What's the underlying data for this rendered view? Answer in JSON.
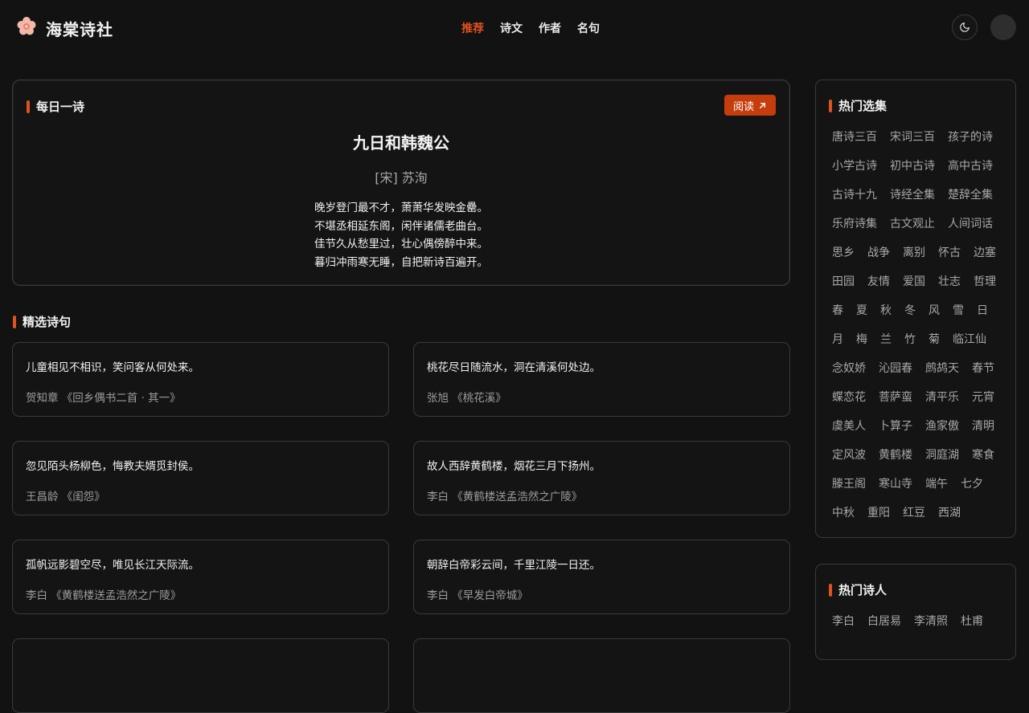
{
  "header": {
    "brand": "海棠诗社",
    "nav": [
      {
        "label": "推荐",
        "active": true
      },
      {
        "label": "诗文",
        "active": false
      },
      {
        "label": "作者",
        "active": false
      },
      {
        "label": "名句",
        "active": false
      }
    ],
    "theme_icon": "moon-icon",
    "logo_icon": "flower-icon"
  },
  "daily": {
    "section_title": "每日一诗",
    "read_label": "阅读",
    "read_icon": "arrow-up-right-icon",
    "title": "九日和韩魏公",
    "author": "[宋] 苏洵",
    "lines": [
      "晚岁登门最不才，萧萧华发映金罍。",
      "不堪丞相延东阁，闲伴诸儒老曲台。",
      "佳节久从愁里过，壮心偶傍醉中来。",
      "暮归冲雨寒无睡，自把新诗百遍开。"
    ]
  },
  "featured": {
    "section_title": "精选诗句",
    "quotes": [
      {
        "text": "儿童相见不相识，笑问客从何处来。",
        "source": "贺知章 《回乡偶书二首 · 其一》"
      },
      {
        "text": "桃花尽日随流水，洞在清溪何处边。",
        "source": "张旭 《桃花溪》"
      },
      {
        "text": "忽见陌头杨柳色，悔教夫婿觅封侯。",
        "source": "王昌龄 《闺怨》"
      },
      {
        "text": "故人西辞黄鹤楼，烟花三月下扬州。",
        "source": "李白 《黄鹤楼送孟浩然之广陵》"
      },
      {
        "text": "孤帆远影碧空尽，唯见长江天际流。",
        "source": "李白 《黄鹤楼送孟浩然之广陵》"
      },
      {
        "text": "朝辞白帝彩云间，千里江陵一日还。",
        "source": "李白 《早发白帝城》"
      }
    ]
  },
  "sidebar": {
    "collections_title": "热门选集",
    "collections": [
      "唐诗三百",
      "宋词三百",
      "孩子的诗",
      "小学古诗",
      "初中古诗",
      "高中古诗",
      "古诗十九",
      "诗经全集",
      "楚辞全集",
      "乐府诗集",
      "古文观止",
      "人间词话",
      "思乡",
      "战争",
      "离别",
      "怀古",
      "边塞",
      "田园",
      "友情",
      "爱国",
      "壮志",
      "哲理",
      "春",
      "夏",
      "秋",
      "冬",
      "风",
      "雪",
      "日",
      "月",
      "梅",
      "兰",
      "竹",
      "菊",
      "临江仙",
      "念奴娇",
      "沁园春",
      "鹧鸪天",
      "春节",
      "蝶恋花",
      "菩萨蛮",
      "清平乐",
      "元宵",
      "虞美人",
      "卜算子",
      "渔家傲",
      "清明",
      "定风波",
      "黄鹤楼",
      "洞庭湖",
      "寒食",
      "滕王阁",
      "寒山寺",
      "端午",
      "七夕",
      "中秋",
      "重阳",
      "红豆",
      "西湖"
    ],
    "poets_title": "热门诗人",
    "poets": [
      "李白",
      "白居易",
      "李清照",
      "杜甫"
    ]
  },
  "colors": {
    "accent": "#e0521f",
    "button": "#c53d0c",
    "background": "#121212"
  }
}
